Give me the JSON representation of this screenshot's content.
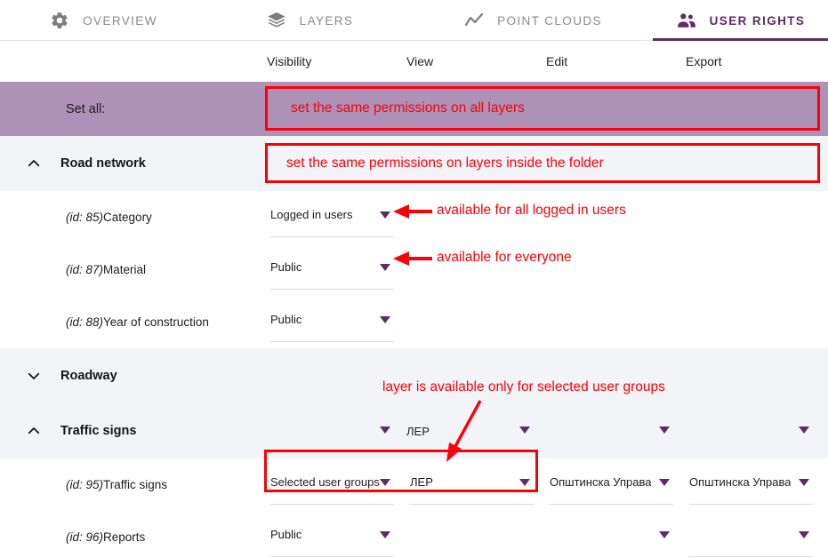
{
  "tabs": [
    {
      "id": "overview",
      "label": "OVERVIEW",
      "icon": "gear-icon",
      "active": false
    },
    {
      "id": "layers",
      "label": "LAYERS",
      "icon": "layers-icon",
      "active": false
    },
    {
      "id": "point-clouds",
      "label": "POINT CLOUDS",
      "icon": "point-cloud-icon",
      "active": false
    },
    {
      "id": "user-rights",
      "label": "USER RIGHTS",
      "icon": "users-icon",
      "active": true
    }
  ],
  "columns": [
    {
      "key": "visibility",
      "label": "Visibility"
    },
    {
      "key": "view",
      "label": "View"
    },
    {
      "key": "edit",
      "label": "Edit"
    },
    {
      "key": "export",
      "label": "Export"
    }
  ],
  "set_all": {
    "label": "Set all:"
  },
  "rows": [
    {
      "type": "folder",
      "name": "Road network",
      "chevron": "chevron-up-icon",
      "cells": [
        {
          "value": ""
        },
        {
          "value": ""
        },
        {
          "value": ""
        },
        {
          "value": ""
        }
      ]
    },
    {
      "type": "layer",
      "id_label": "(id: 85)",
      "name": "Category",
      "cells": [
        {
          "value": "Logged in users",
          "underline": true
        },
        {
          "value": "",
          "underline": false
        },
        {
          "value": "",
          "underline": false
        },
        {
          "value": "",
          "underline": false
        }
      ]
    },
    {
      "type": "layer",
      "id_label": "(id: 87)",
      "name": "Material",
      "cells": [
        {
          "value": "Public",
          "underline": true
        },
        {
          "value": "",
          "underline": false
        },
        {
          "value": "",
          "underline": false
        },
        {
          "value": "",
          "underline": false
        }
      ]
    },
    {
      "type": "layer",
      "id_label": "(id: 88)",
      "name": "Year of construction",
      "cells": [
        {
          "value": "Public",
          "underline": true
        },
        {
          "value": "",
          "underline": false
        },
        {
          "value": "",
          "underline": false
        },
        {
          "value": "",
          "underline": false
        }
      ]
    },
    {
      "type": "folder",
      "name": "Roadway",
      "chevron": "chevron-down-icon",
      "cells": [
        {
          "value": ""
        },
        {
          "value": ""
        },
        {
          "value": ""
        },
        {
          "value": ""
        }
      ]
    },
    {
      "type": "folder",
      "name": "Traffic signs",
      "chevron": "chevron-up-icon",
      "cells": [
        {
          "value": "",
          "arrow": true
        },
        {
          "value": "ЛЕР",
          "arrow": true
        },
        {
          "value": "",
          "arrow": true
        },
        {
          "value": "",
          "arrow": true
        }
      ]
    },
    {
      "type": "layer",
      "id_label": "(id: 95)",
      "name": "Traffic signs",
      "cells": [
        {
          "value": "Selected user groups",
          "underline": true
        },
        {
          "value": "ЛЕР",
          "underline": true
        },
        {
          "value": "Општинска Управа",
          "underline": true
        },
        {
          "value": "Општинска Управа",
          "underline": true
        }
      ]
    },
    {
      "type": "layer",
      "id_label": "(id: 96)",
      "name": "Reports",
      "cells": [
        {
          "value": "Public",
          "underline": true
        },
        {
          "value": "",
          "underline": false
        },
        {
          "value": "",
          "underline": true
        },
        {
          "value": "",
          "underline": true
        }
      ]
    }
  ],
  "annotations": {
    "set_all_note": "set the same permissions on all layers",
    "folder_note": "set the same permissions on layers inside the folder",
    "logged_in_note": "available for all logged in users",
    "everyone_note": "available for everyone",
    "selected_groups_note": "layer is available  only for selected user groups"
  },
  "colors": {
    "accent_purple": "#5e2a68",
    "setall_row": "#ad91b7",
    "folder_row": "#f3f4f8",
    "annotation_red": "#fb0007",
    "tab_inactive": "#8a8a8f"
  }
}
